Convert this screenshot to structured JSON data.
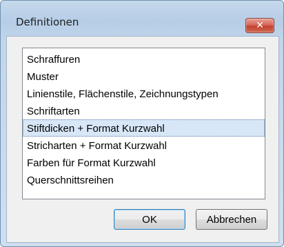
{
  "window": {
    "title": "Definitionen",
    "close_symbol": "✕"
  },
  "list": {
    "items": [
      "Schraffuren",
      "Muster",
      "Linienstile, Flächenstile, Zeichnungstypen",
      "Schriftarten",
      "Stiftdicken + Format Kurzwahl",
      "Stricharten + Format Kurzwahl",
      "Farben für Format Kurzwahl",
      "Querschnittsreihen"
    ],
    "selected_index": 4
  },
  "buttons": {
    "ok_label": "OK",
    "cancel_label": "Abbrechen"
  }
}
